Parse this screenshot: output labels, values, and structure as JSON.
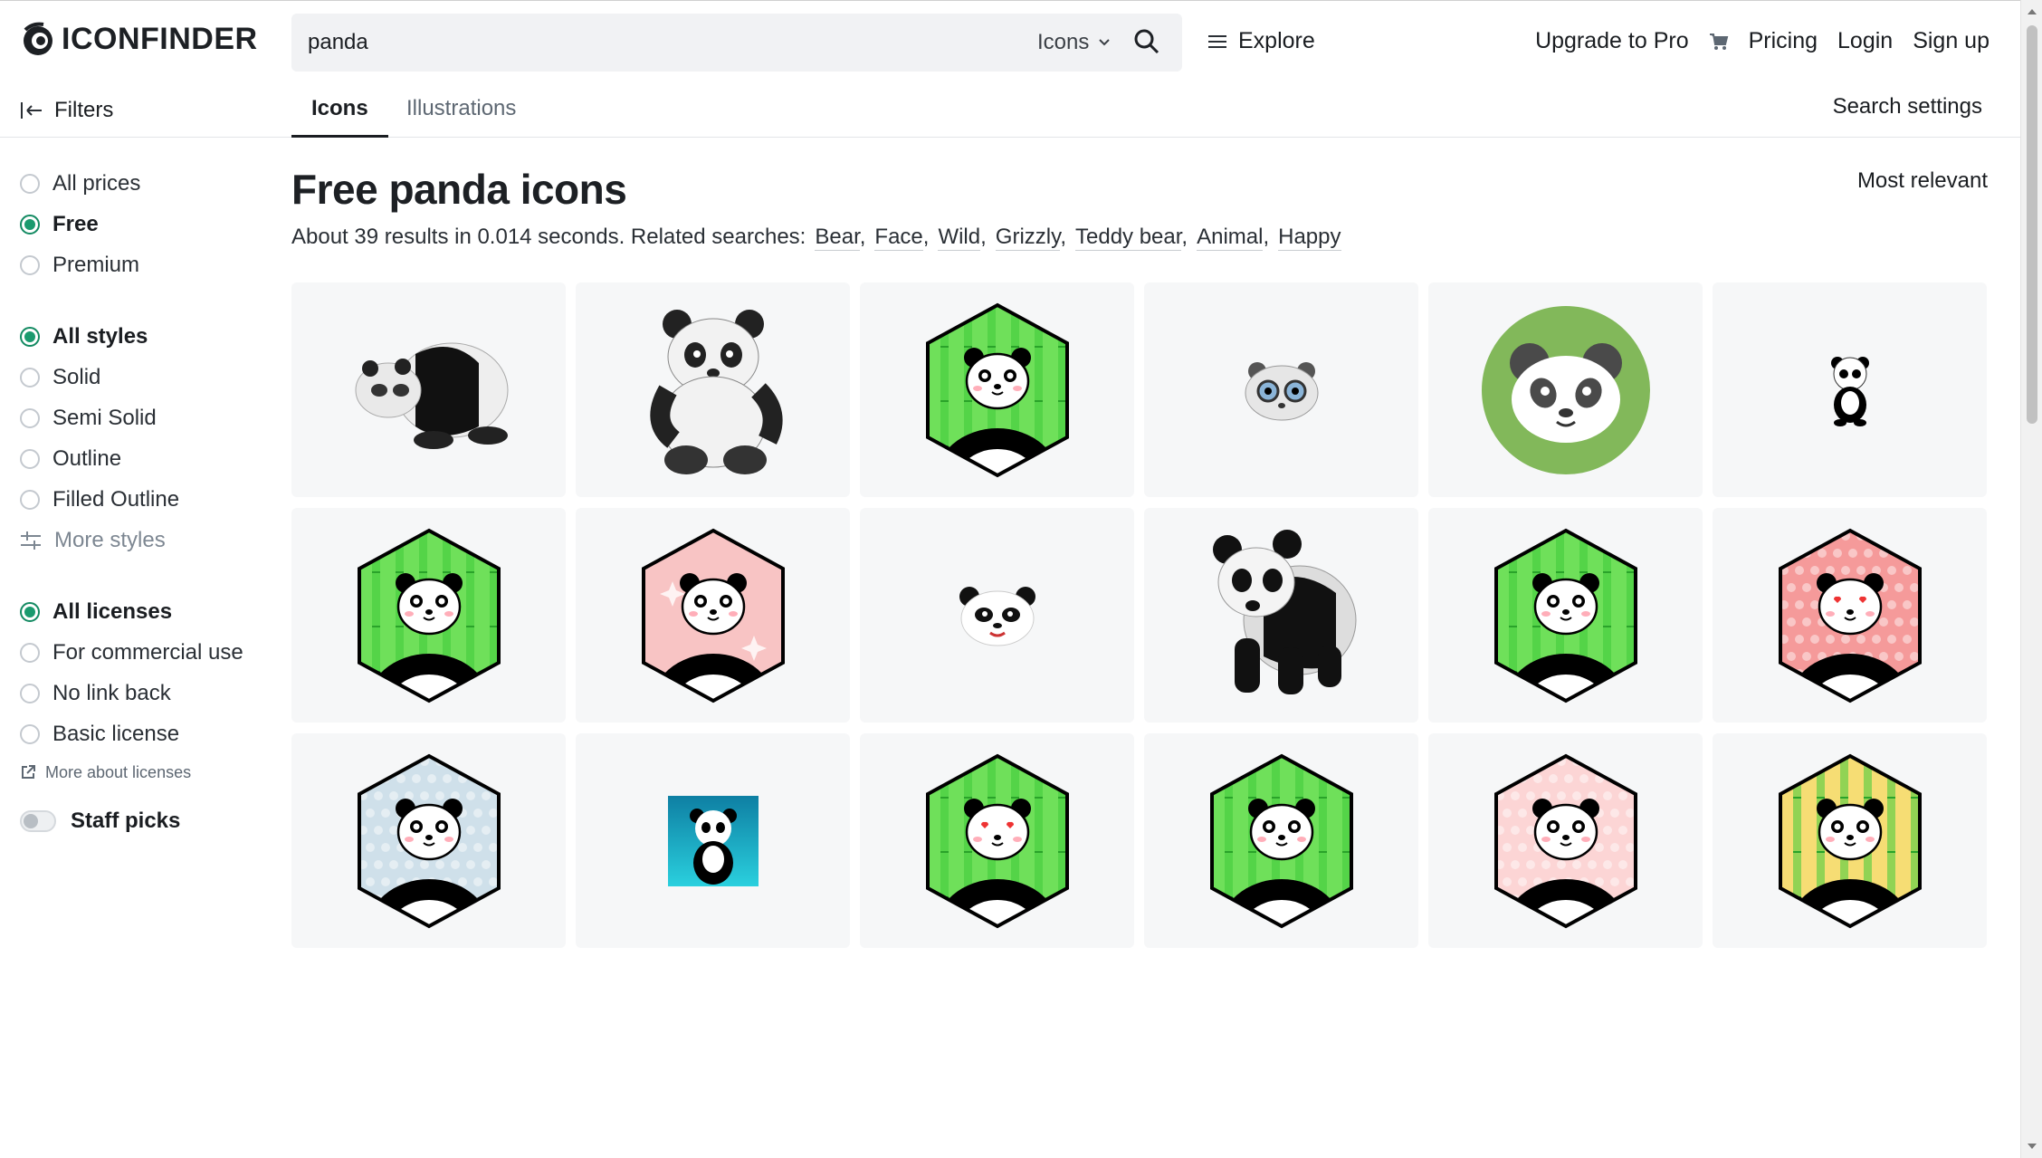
{
  "header": {
    "logo_text": "ICONFINDER",
    "search": {
      "value": "panda",
      "type_label": "Icons"
    },
    "explore_label": "Explore",
    "nav": {
      "upgrade": "Upgrade to Pro",
      "pricing": "Pricing",
      "login": "Login",
      "signup": "Sign up"
    }
  },
  "tabs": {
    "filters_label": "Filters",
    "icons": "Icons",
    "illustrations": "Illustrations",
    "search_settings": "Search settings"
  },
  "sidebar": {
    "prices": [
      "All prices",
      "Free",
      "Premium"
    ],
    "styles": [
      "All styles",
      "Solid",
      "Semi Solid",
      "Outline",
      "Filled Outline"
    ],
    "more_styles": "More styles",
    "licenses": [
      "All licenses",
      "For commercial use",
      "No link back",
      "Basic license"
    ],
    "more_about_licenses": "More about licenses",
    "staff_picks": "Staff picks"
  },
  "main": {
    "title": "Free panda icons",
    "sort": "Most relevant",
    "results_text": "About 39 results in 0.014 seconds. Related searches:",
    "related": [
      "Bear",
      "Face",
      "Wild",
      "Grizzly",
      "Teddy bear",
      "Animal",
      "Happy"
    ]
  },
  "colors": {
    "accent": "#1a9a6e",
    "bamboo": "#6fe05a",
    "pink": "#f8c4c4",
    "green_circle": "#82b85a"
  },
  "results": [
    "panda-3d-crouching",
    "panda-sketch-sitting",
    "panda-hex-bamboo",
    "panda-face-small",
    "panda-circle-green",
    "panda-tiny-standing",
    "panda-hex-bamboo",
    "panda-hex-pink-sparkle",
    "panda-face-wink",
    "panda-3d-walking",
    "panda-hex-bamboo",
    "panda-hex-red-love",
    "panda-hex-blue-sick",
    "panda-square-teal",
    "panda-hex-bamboo-love",
    "panda-hex-bamboo-smile",
    "panda-hex-pink-dots",
    "panda-hex-yellow-angry"
  ]
}
